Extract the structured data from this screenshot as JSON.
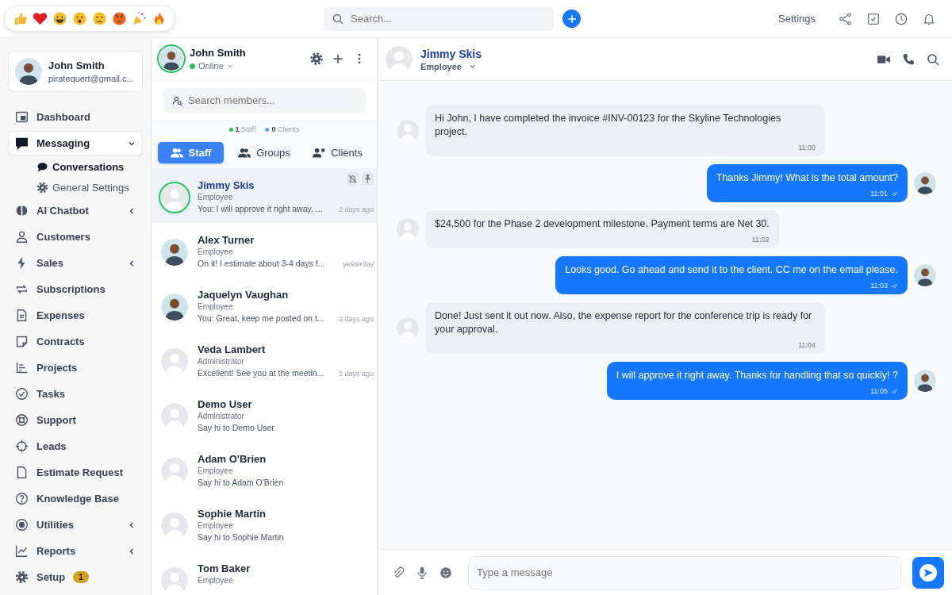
{
  "topbar": {
    "search": {
      "placeholder": "Search..."
    },
    "settings_link": "Settings"
  },
  "profile": {
    "name": "John Smith",
    "email": "piratequert@gmail.c..."
  },
  "nav": [
    {
      "label": "Dashboard",
      "selected": false
    },
    {
      "label": "Messaging",
      "selected": true,
      "expanded": true,
      "children": [
        {
          "label": "Conversations",
          "selected": true
        },
        {
          "label": "General Settings",
          "selected": false
        }
      ]
    },
    {
      "label": "AI Chatbot",
      "selected": false,
      "expanded": false
    },
    {
      "label": "Customers",
      "selected": false
    },
    {
      "label": "Sales",
      "selected": false,
      "expanded": false
    },
    {
      "label": "Subscriptions",
      "selected": false
    },
    {
      "label": "Expenses",
      "selected": false
    },
    {
      "label": "Contracts",
      "selected": false
    },
    {
      "label": "Projects",
      "selected": false
    },
    {
      "label": "Tasks",
      "selected": false
    },
    {
      "label": "Support",
      "selected": false
    },
    {
      "label": "Leads",
      "selected": false
    },
    {
      "label": "Estimate Request",
      "selected": false
    },
    {
      "label": "Knowledge Base",
      "selected": false
    },
    {
      "label": "Utilities",
      "selected": false,
      "expanded": false
    },
    {
      "label": "Reports",
      "selected": false,
      "expanded": false
    },
    {
      "label": "Setup",
      "selected": false,
      "badge": "1"
    }
  ],
  "contacts_panel": {
    "user": {
      "name": "John Smith",
      "status": "Online",
      "online": true
    },
    "search": {
      "placeholder": "Search members..."
    },
    "stats": [
      {
        "text": "**1** Staff",
        "color": "#22c55e"
      },
      {
        "text": "**0** Clients",
        "color": "#60a5fa"
      }
    ],
    "tabs": [
      {
        "label": "Staff",
        "selected": true
      },
      {
        "label": "Groups",
        "selected": false
      },
      {
        "label": "Clients",
        "selected": false
      }
    ],
    "contacts": [
      {
        "name": "Jimmy Skis",
        "role": "Employee",
        "preview": "You: I will approve it right away. ...",
        "time": "2 days ago",
        "kind": "default",
        "online": true,
        "selected": true
      },
      {
        "name": "Alex Turner",
        "role": "Employee",
        "preview": "On it! I estimate about 3-4 days f...",
        "time": "yesterday",
        "kind": "photo",
        "online": false,
        "selected": false
      },
      {
        "name": "Jaquelyn Vaughan",
        "role": "Employee",
        "preview": "You: Great, keep me posted on t...",
        "time": "2 days ago",
        "kind": "photo",
        "online": false,
        "selected": false
      },
      {
        "name": "Veda Lambert",
        "role": "Administrator",
        "preview": "Excellent! See you at the meetin...",
        "time": "2 days ago",
        "kind": "default",
        "online": false,
        "selected": false
      },
      {
        "name": "Demo User",
        "role": "Administrator",
        "preview": "Say hi to Demo User",
        "kind": "default",
        "online": false,
        "selected": false
      },
      {
        "name": "Adam O'Brien",
        "role": "Employee",
        "preview": "Say hi to Adam O'Brien",
        "kind": "default",
        "online": false,
        "selected": false
      },
      {
        "name": "Sophie Martin",
        "role": "Employee",
        "preview": "Say hi to Sophie Martin",
        "kind": "default",
        "online": false,
        "selected": false
      },
      {
        "name": "Tom Baker",
        "role": "Employee",
        "kind": "default",
        "online": false,
        "selected": false
      }
    ]
  },
  "chat": {
    "name": "Jimmy Skis",
    "role": "Employee",
    "composer": {
      "placeholder": "Type a message"
    },
    "messages": [
      {
        "kind": "incoming",
        "text": "Hi John, I have completed the invoice #INV-00123 for the Skyline Technologies project.",
        "time": "11:00"
      },
      {
        "kind": "outgoing",
        "text": "Thanks Jimmy! What is the total amount?",
        "time": "11:01",
        "read": true
      },
      {
        "kind": "incoming",
        "text": "$24,500 for the Phase 2 development milestone. Payment terms are Net 30.",
        "time": "11:02"
      },
      {
        "kind": "outgoing",
        "text": "Looks good. Go ahead and send it to the client. CC me on the email please.",
        "time": "11:03",
        "read": true
      },
      {
        "kind": "incoming",
        "text": "Done! Just sent it out now. Also, the expense report for the conference trip is ready for your approval.",
        "time": "11:04"
      },
      {
        "kind": "outgoing",
        "text": "I will approve it right away. Thanks for handling that so quickly! ?",
        "time": "11:05",
        "read": true
      }
    ]
  }
}
